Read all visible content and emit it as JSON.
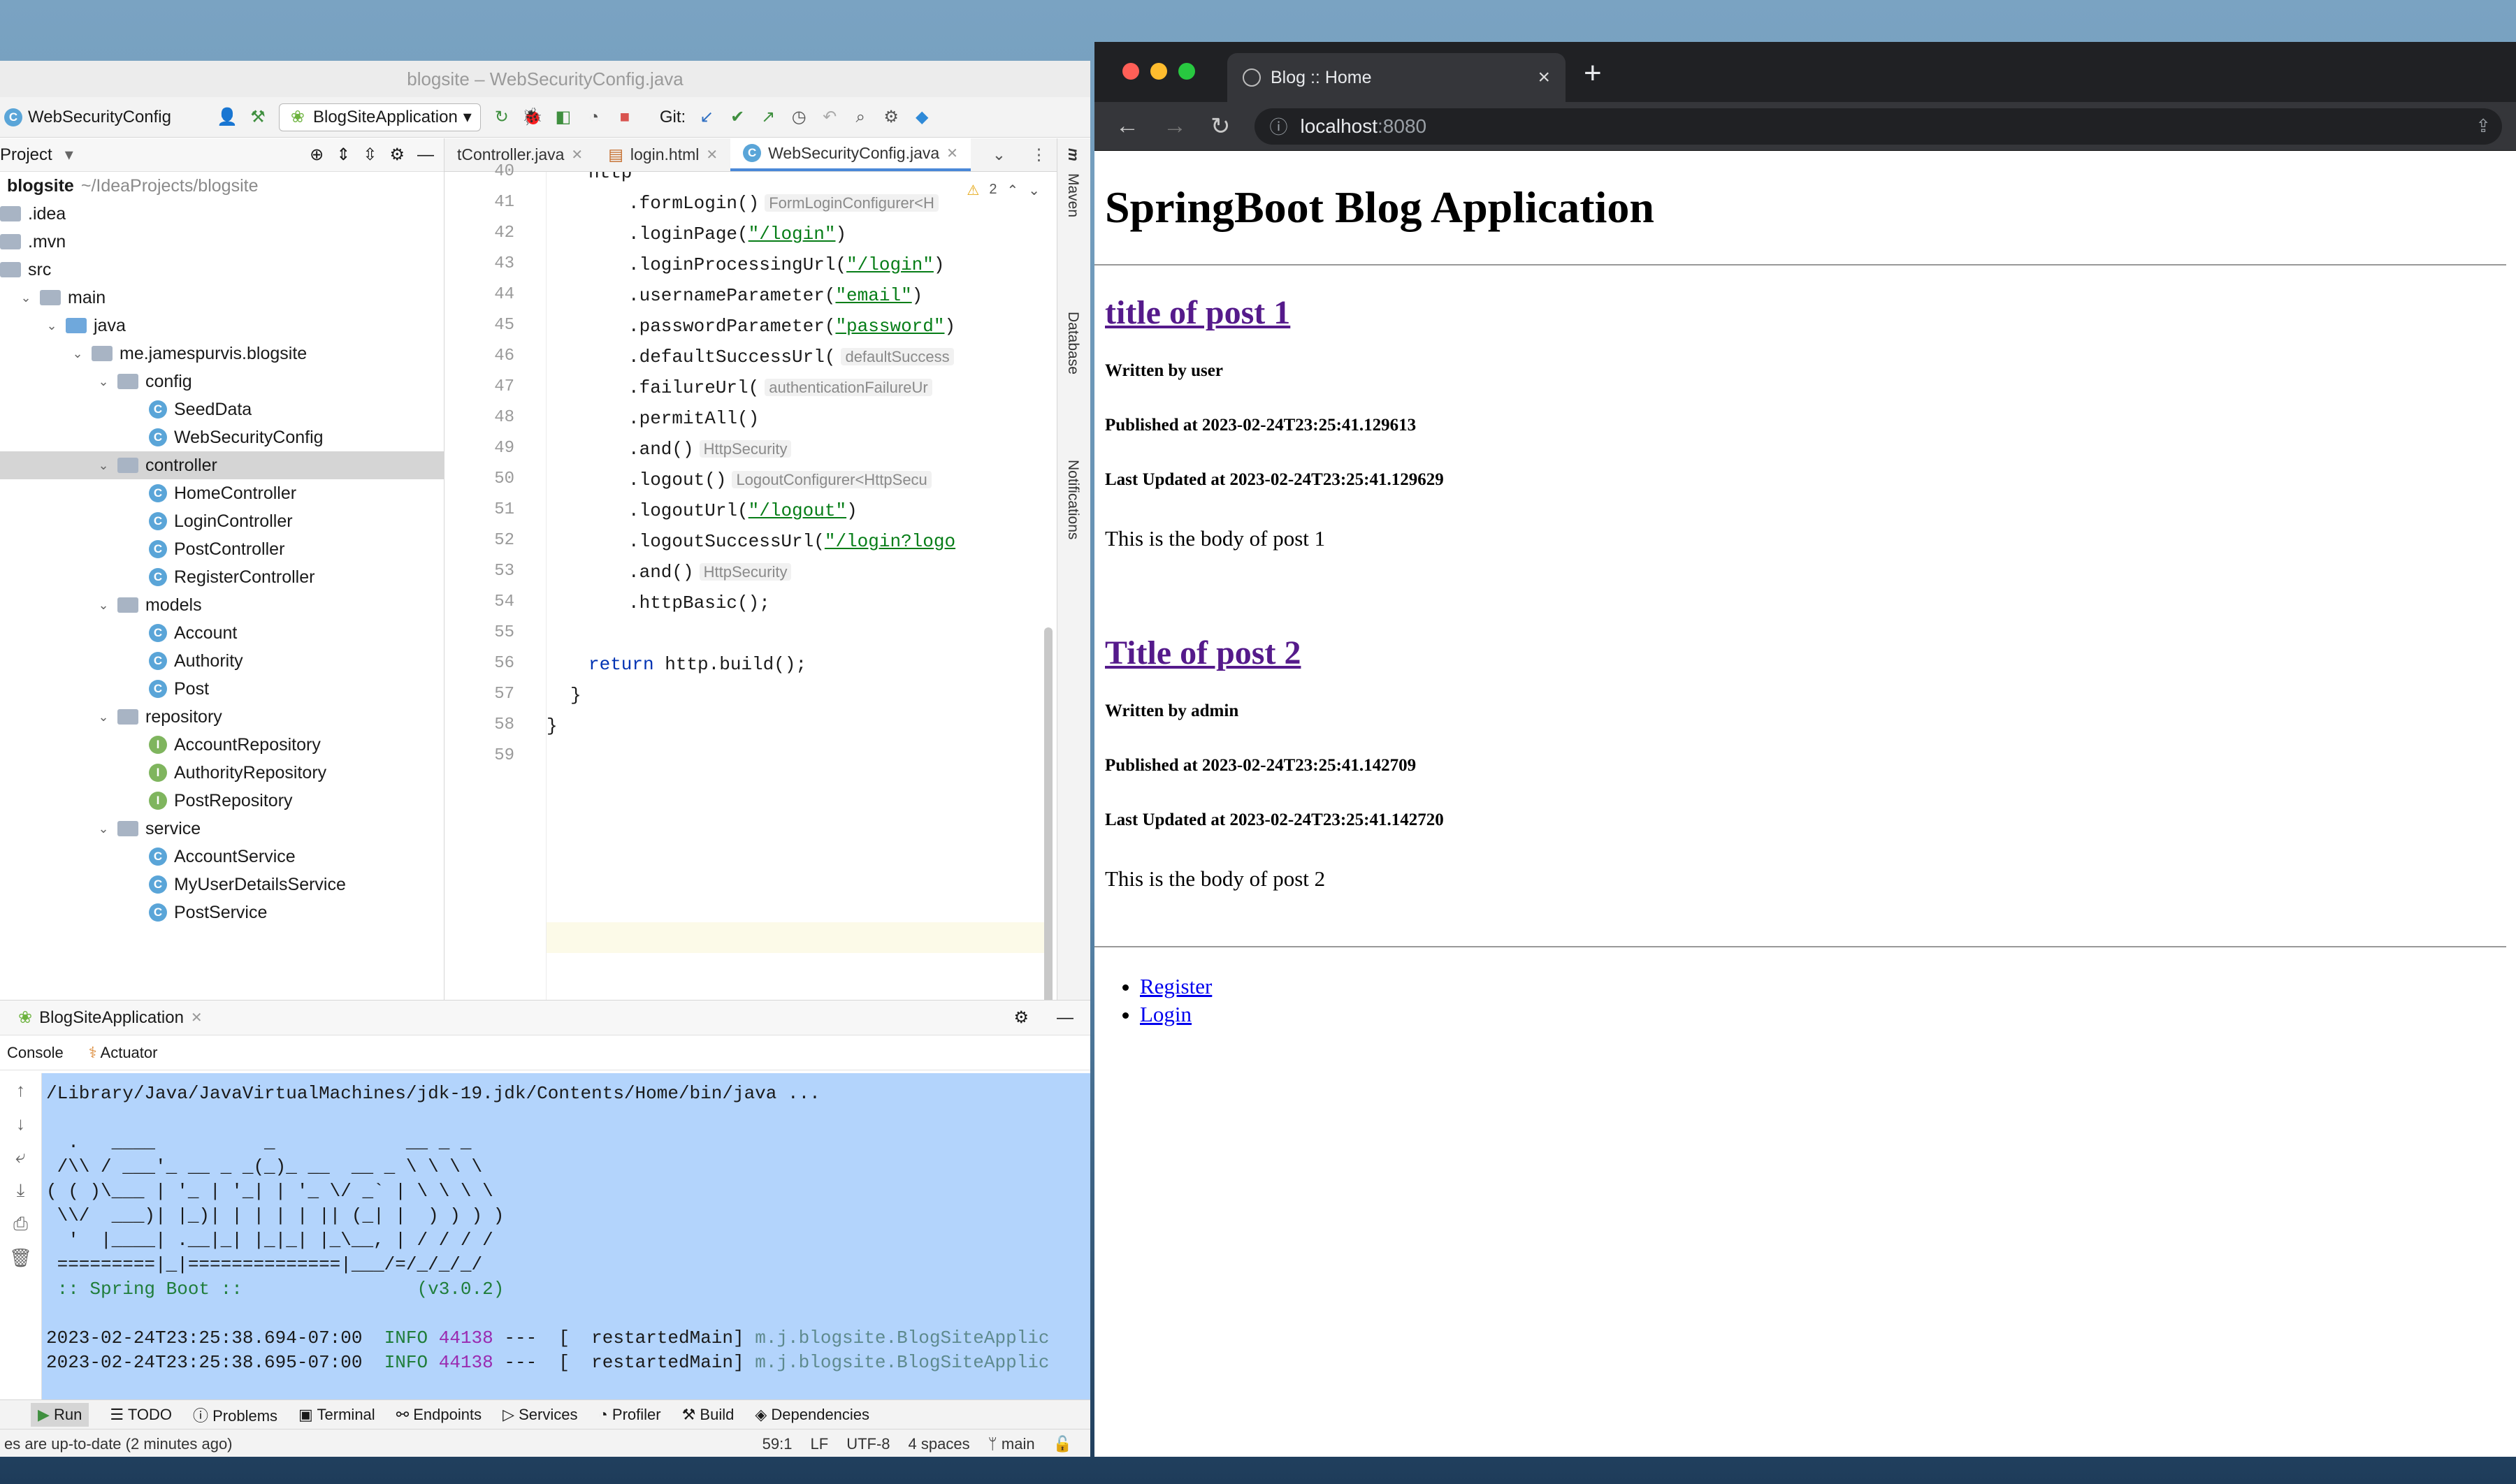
{
  "ide": {
    "title": "blogsite – WebSecurityConfig.java",
    "toolbar": {
      "breadcrumb_file": "WebSecurityConfig",
      "run_config": "BlogSiteApplication",
      "git_label": "Git:"
    },
    "project_panel": {
      "title": "Project",
      "root_name": "blogsite",
      "root_path": "~/IdeaProjects/blogsite",
      "tree": [
        {
          "label": "blogsite",
          "depth": 0,
          "kind": "root"
        },
        {
          "label": ".idea",
          "depth": 0,
          "kind": "folder"
        },
        {
          "label": ".mvn",
          "depth": 0,
          "kind": "folder"
        },
        {
          "label": "src",
          "depth": 0,
          "kind": "folder"
        },
        {
          "label": "main",
          "depth": 1,
          "kind": "folder"
        },
        {
          "label": "java",
          "depth": 2,
          "kind": "folder-blue"
        },
        {
          "label": "me.jamespurvis.blogsite",
          "depth": 3,
          "kind": "folder"
        },
        {
          "label": "config",
          "depth": 4,
          "kind": "folder"
        },
        {
          "label": "SeedData",
          "depth": 5,
          "kind": "class"
        },
        {
          "label": "WebSecurityConfig",
          "depth": 5,
          "kind": "class"
        },
        {
          "label": "controller",
          "depth": 4,
          "kind": "folder"
        },
        {
          "label": "HomeController",
          "depth": 5,
          "kind": "class"
        },
        {
          "label": "LoginController",
          "depth": 5,
          "kind": "class"
        },
        {
          "label": "PostController",
          "depth": 5,
          "kind": "class"
        },
        {
          "label": "RegisterController",
          "depth": 5,
          "kind": "class"
        },
        {
          "label": "models",
          "depth": 4,
          "kind": "folder"
        },
        {
          "label": "Account",
          "depth": 5,
          "kind": "class"
        },
        {
          "label": "Authority",
          "depth": 5,
          "kind": "class"
        },
        {
          "label": "Post",
          "depth": 5,
          "kind": "class"
        },
        {
          "label": "repository",
          "depth": 4,
          "kind": "folder"
        },
        {
          "label": "AccountRepository",
          "depth": 5,
          "kind": "interface"
        },
        {
          "label": "AuthorityRepository",
          "depth": 5,
          "kind": "interface"
        },
        {
          "label": "PostRepository",
          "depth": 5,
          "kind": "interface"
        },
        {
          "label": "service",
          "depth": 4,
          "kind": "folder"
        },
        {
          "label": "AccountService",
          "depth": 5,
          "kind": "class"
        },
        {
          "label": "MyUserDetailsService",
          "depth": 5,
          "kind": "class"
        },
        {
          "label": "PostService",
          "depth": 5,
          "kind": "class"
        }
      ]
    },
    "editor_tabs": [
      "tController.java",
      "login.html",
      "WebSecurityConfig.java"
    ],
    "warning_count": "2",
    "code_lines": [
      {
        "n": "40",
        "indent": 2,
        "text": "http"
      },
      {
        "n": "41",
        "indent": 3,
        "text": ".formLogin()",
        "hint": "FormLoginConfigurer<H"
      },
      {
        "n": "42",
        "indent": 3,
        "text": ".loginPage(",
        "str": "\"/login\"",
        "tail": ")"
      },
      {
        "n": "43",
        "indent": 3,
        "text": ".loginProcessingUrl(",
        "str": "\"/login\"",
        "tail": ")"
      },
      {
        "n": "44",
        "indent": 3,
        "text": ".usernameParameter(",
        "str": "\"email\"",
        "tail": ")"
      },
      {
        "n": "45",
        "indent": 3,
        "text": ".passwordParameter(",
        "str": "\"password\"",
        "tail": ")"
      },
      {
        "n": "46",
        "indent": 3,
        "text": ".defaultSuccessUrl(",
        "hint": "defaultSuccess"
      },
      {
        "n": "47",
        "indent": 3,
        "text": ".failureUrl(",
        "hint": "authenticationFailureUr"
      },
      {
        "n": "48",
        "indent": 3,
        "text": ".permitAll()"
      },
      {
        "n": "49",
        "indent": 3,
        "text": ".and()",
        "hint": "HttpSecurity"
      },
      {
        "n": "50",
        "indent": 3,
        "text": ".logout()",
        "hint": "LogoutConfigurer<HttpSecu"
      },
      {
        "n": "51",
        "indent": 3,
        "text": ".logoutUrl(",
        "str": "\"/logout\"",
        "tail": ")"
      },
      {
        "n": "52",
        "indent": 3,
        "text": ".logoutSuccessUrl(",
        "str": "\"/login?logo"
      },
      {
        "n": "53",
        "indent": 3,
        "text": ".and()",
        "hint": "HttpSecurity"
      },
      {
        "n": "54",
        "indent": 3,
        "text": ".httpBasic();"
      },
      {
        "n": "55",
        "indent": 0,
        "text": ""
      },
      {
        "n": "56",
        "indent": 2,
        "kw": "return",
        "text": " http.build();"
      },
      {
        "n": "57",
        "indent": 1,
        "text": "}"
      },
      {
        "n": "58",
        "indent": 0,
        "text": "}"
      },
      {
        "n": "59",
        "indent": 0,
        "text": ""
      }
    ],
    "side_tools": [
      "Maven",
      "Database",
      "Notifications"
    ],
    "run_panel": {
      "tab": "BlogSiteApplication",
      "subtabs": [
        "Console",
        "Actuator"
      ],
      "console_lines": [
        "/Library/Java/JavaVirtualMachines/jdk-19.jdk/Contents/Home/bin/java ...",
        "",
        "  .   ____          _            __ _ _",
        " /\\\\ / ___'_ __ _ _(_)_ __  __ _ \\ \\ \\ \\",
        "( ( )\\___ | '_ | '_| | '_ \\/ _` | \\ \\ \\ \\",
        " \\\\/  ___)| |_)| | | | | || (_| |  ) ) ) )",
        "  '  |____| .__|_| |_|_| |_\\__, | / / / /",
        " =========|_|==============|___/=/_/_/_/",
        " :: Spring Boot ::                (v3.0.2)",
        ""
      ],
      "log_lines": [
        {
          "time": "2023-02-24T23:25:38.694-07:00",
          "level": "INFO",
          "pid": "44138",
          "thread": "---  [  restartedMain]",
          "logger": "m.j.blogsite.BlogSiteApplic"
        },
        {
          "time": "2023-02-24T23:25:38.695-07:00",
          "level": "INFO",
          "pid": "44138",
          "thread": "---  [  restartedMain]",
          "logger": "m.j.blogsite.BlogSiteApplic"
        }
      ]
    },
    "bottom_tools": [
      "Run",
      "TODO",
      "Problems",
      "Terminal",
      "Endpoints",
      "Services",
      "Profiler",
      "Build",
      "Dependencies"
    ],
    "status": {
      "message": "es are up-to-date (2 minutes ago)",
      "position": "59:1",
      "line_sep": "LF",
      "encoding": "UTF-8",
      "indent": "4 spaces",
      "branch": "main"
    }
  },
  "browser": {
    "tab_title": "Blog :: Home",
    "url_host": "localhost",
    "url_port": ":8080",
    "page": {
      "heading": "SpringBoot Blog Application",
      "posts": [
        {
          "title": "title of post 1",
          "author": "Written by user",
          "published": "Published at 2023-02-24T23:25:41.129613",
          "updated": "Last Updated at 2023-02-24T23:25:41.129629",
          "body": "This is the body of post 1"
        },
        {
          "title": "Title of post 2",
          "author": "Written by admin",
          "published": "Published at 2023-02-24T23:25:41.142709",
          "updated": "Last Updated at 2023-02-24T23:25:41.142720",
          "body": "This is the body of post 2"
        }
      ],
      "links": [
        "Register",
        "Login"
      ]
    }
  }
}
